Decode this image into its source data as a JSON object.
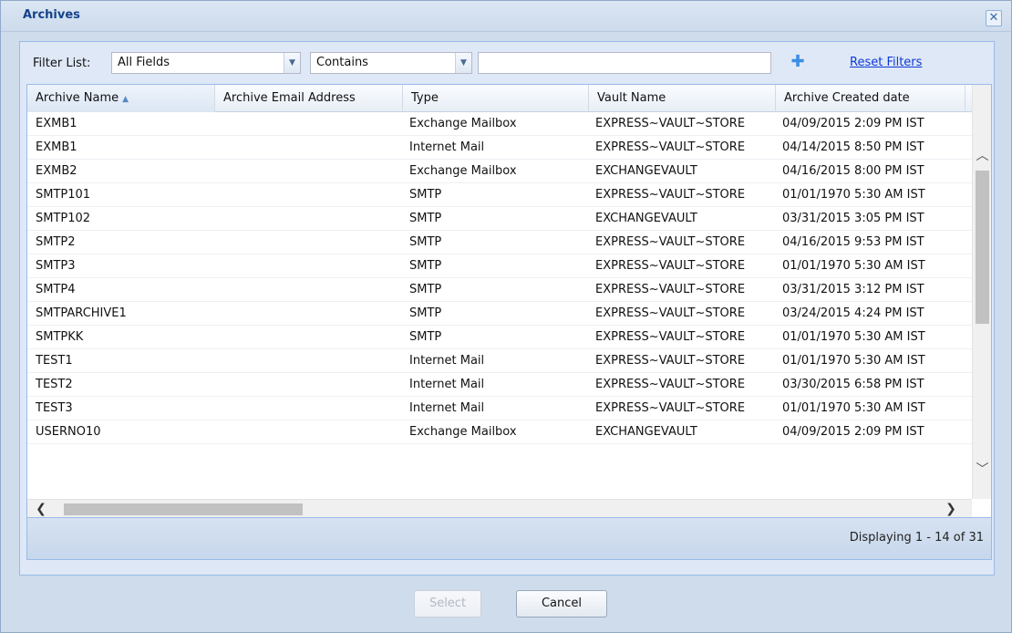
{
  "window": {
    "title": "Archives",
    "close_glyph": "✕"
  },
  "filter": {
    "label": "Filter List:",
    "field_value": "All Fields",
    "operator_value": "Contains",
    "search_value": "",
    "add_icon": "plus-icon",
    "reset_label": "Reset Filters"
  },
  "columns": [
    "Archive Name",
    "Archive Email Address",
    "Type",
    "Vault Name",
    "Archive Created date"
  ],
  "sort": {
    "column": "Archive Name",
    "direction": "ascending"
  },
  "rows": [
    {
      "name": "EXMB1",
      "email": "",
      "type": "Exchange Mailbox",
      "vault": "EXPRESS~VAULT~STORE",
      "created": "04/09/2015 2:09 PM IST"
    },
    {
      "name": "EXMB1",
      "email": "",
      "type": "Internet Mail",
      "vault": "EXPRESS~VAULT~STORE",
      "created": "04/14/2015 8:50 PM IST"
    },
    {
      "name": "EXMB2",
      "email": "",
      "type": "Exchange Mailbox",
      "vault": "EXCHANGEVAULT",
      "created": "04/16/2015 8:00 PM IST"
    },
    {
      "name": "SMTP101",
      "email": "",
      "type": "SMTP",
      "vault": "EXPRESS~VAULT~STORE",
      "created": "01/01/1970 5:30 AM IST"
    },
    {
      "name": "SMTP102",
      "email": "",
      "type": "SMTP",
      "vault": "EXCHANGEVAULT",
      "created": "03/31/2015 3:05 PM IST"
    },
    {
      "name": "SMTP2",
      "email": "",
      "type": "SMTP",
      "vault": "EXPRESS~VAULT~STORE",
      "created": "04/16/2015 9:53 PM IST"
    },
    {
      "name": "SMTP3",
      "email": "",
      "type": "SMTP",
      "vault": "EXPRESS~VAULT~STORE",
      "created": "01/01/1970 5:30 AM IST"
    },
    {
      "name": "SMTP4",
      "email": "",
      "type": "SMTP",
      "vault": "EXPRESS~VAULT~STORE",
      "created": "03/31/2015 3:12 PM IST"
    },
    {
      "name": "SMTPARCHIVE1",
      "email": "",
      "type": "SMTP",
      "vault": "EXPRESS~VAULT~STORE",
      "created": "03/24/2015 4:24 PM IST"
    },
    {
      "name": "SMTPKK",
      "email": "",
      "type": "SMTP",
      "vault": "EXPRESS~VAULT~STORE",
      "created": "01/01/1970 5:30 AM IST"
    },
    {
      "name": "TEST1",
      "email": "",
      "type": "Internet Mail",
      "vault": "EXPRESS~VAULT~STORE",
      "created": "01/01/1970 5:30 AM IST"
    },
    {
      "name": "TEST2",
      "email": "",
      "type": "Internet Mail",
      "vault": "EXPRESS~VAULT~STORE",
      "created": "03/30/2015 6:58 PM IST"
    },
    {
      "name": "TEST3",
      "email": "",
      "type": "Internet Mail",
      "vault": "EXPRESS~VAULT~STORE",
      "created": "01/01/1970 5:30 AM IST"
    },
    {
      "name": "USERNO10",
      "email": "",
      "type": "Exchange Mailbox",
      "vault": "EXCHANGEVAULT",
      "created": "04/09/2015 2:09 PM IST"
    }
  ],
  "paging": {
    "text": "Displaying 1 - 14 of 31"
  },
  "buttons": {
    "select_label": "Select",
    "select_enabled": false,
    "cancel_label": "Cancel"
  }
}
